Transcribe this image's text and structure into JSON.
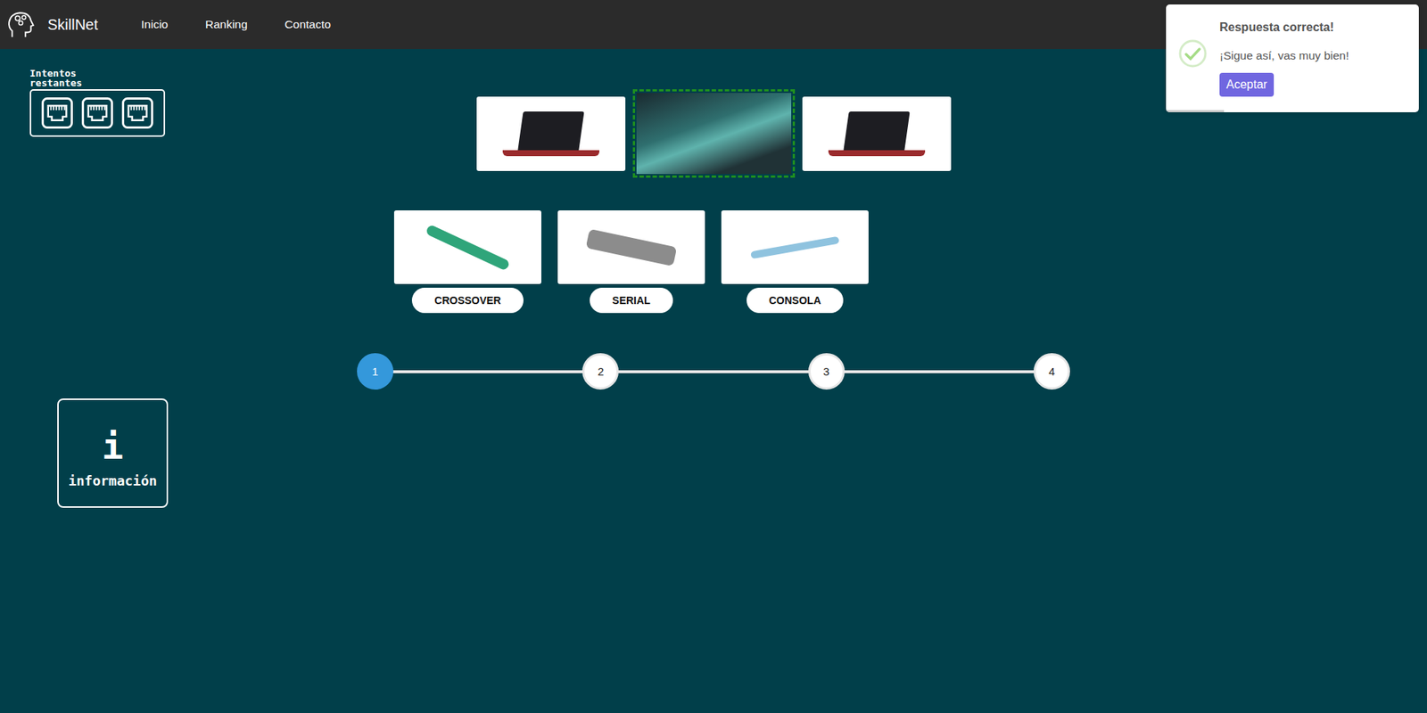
{
  "navbar": {
    "brand": "SkillNet",
    "links": [
      {
        "label": "Inicio"
      },
      {
        "label": "Ranking"
      },
      {
        "label": "Contacto"
      }
    ]
  },
  "attempts": {
    "label": "Intentos restantes",
    "lives": [
      {
        "remaining": true
      },
      {
        "remaining": true
      },
      {
        "remaining": true
      }
    ]
  },
  "connection": [
    {
      "kind": "device"
    },
    {
      "kind": "slot",
      "filled": true,
      "correct": true
    },
    {
      "kind": "device"
    }
  ],
  "options": [
    {
      "label": "CROSSOVER"
    },
    {
      "label": "SERIAL"
    },
    {
      "label": "CONSOLA"
    }
  ],
  "steps": [
    {
      "label": "1",
      "selected": true
    },
    {
      "label": "2",
      "selected": false
    },
    {
      "label": "3",
      "selected": false
    },
    {
      "label": "4",
      "selected": false
    }
  ],
  "info": {
    "icon": "i",
    "label": "información"
  },
  "toast": {
    "title": "Respuesta correcta!",
    "message": "¡Sigue así, vas muy bien!",
    "button": "Aceptar",
    "timer_level": 0.23
  }
}
